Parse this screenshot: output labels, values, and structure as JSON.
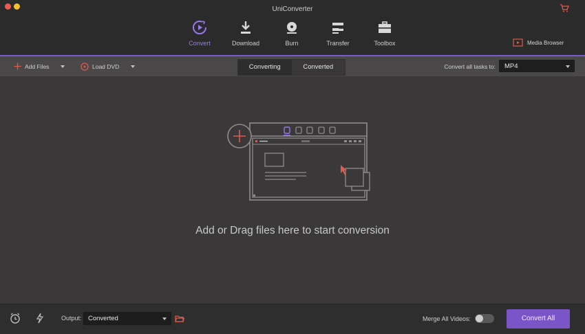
{
  "window": {
    "title": "UniConverter",
    "traffic_colors": [
      "#ee5a52",
      "#f6be2e"
    ]
  },
  "nav": {
    "items": [
      {
        "label": "Convert",
        "icon": "convert-icon",
        "active": true
      },
      {
        "label": "Download",
        "icon": "download-icon",
        "active": false
      },
      {
        "label": "Burn",
        "icon": "burn-icon",
        "active": false
      },
      {
        "label": "Transfer",
        "icon": "transfer-icon",
        "active": false
      },
      {
        "label": "Toolbox",
        "icon": "toolbox-icon",
        "active": false
      }
    ],
    "media_browser_label": "Media Browser",
    "accent_color": "#9a78f0"
  },
  "toolbar": {
    "add_files_label": "Add Files",
    "load_dvd_label": "Load DVD",
    "tabs": [
      "Converting",
      "Converted"
    ],
    "active_tab": "Converting",
    "convert_all_label": "Convert all tasks to:",
    "format_value": "MP4"
  },
  "main": {
    "drop_text": "Add or Drag files here to start conversion"
  },
  "bottom": {
    "output_label": "Output:",
    "output_value": "Converted",
    "merge_label": "Merge All Videos:",
    "merge_on": false,
    "convert_all_button": "Convert All",
    "button_color": "#7a55c8"
  }
}
